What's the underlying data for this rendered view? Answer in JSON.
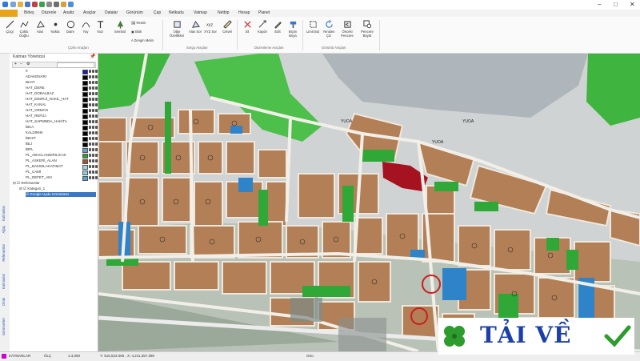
{
  "menu": {
    "file": "",
    "tabs": [
      "Birleş",
      "Düzenle",
      "Analiz",
      "Araçlar",
      "Datalar",
      "Görünüm",
      "Çap",
      "Netkadu",
      "Vatmap",
      "Netbip",
      "Hesap",
      "Planet"
    ]
  },
  "ribbon": {
    "buttons": [
      "Çizgi",
      "Çoklu Doğru",
      "Alan",
      "Nokta",
      "Daire",
      "Yay",
      "Yazı",
      "Sembol",
      "Obje Özellikleri",
      "Alan Sor",
      "XYZ Sor",
      "Cetvel",
      "Sil",
      "Kaydır",
      "Edit",
      "Biçim Boya",
      "Limit Bul",
      "Yeniden Çiz",
      "Önceki Pencere",
      "Pencere Büyüt"
    ],
    "small": [
      "Resim",
      "Blok",
      "Zengin Metin"
    ],
    "groups": [
      "Çizim Araçları",
      "Sorgu Araçları",
      "Düzenleme Araçları",
      "Görüntü Araçları"
    ]
  },
  "layers_panel": {
    "title": "Katman Yöneticisi",
    "items": [
      {
        "name": "0",
        "color": "#1a1ab5"
      },
      {
        "name": "ADAKENARI",
        "color": "#000000"
      },
      {
        "name": "BHAT",
        "color": "#000000"
      },
      {
        "name": "HAT_DERE",
        "color": "#000000"
      },
      {
        "name": "HAT_DOBALBAZ",
        "color": "#000000"
      },
      {
        "name": "HAT_ENERJİ_NAKİL_HAT",
        "color": "#000000"
      },
      {
        "name": "HAT_KANAL",
        "color": "#000000"
      },
      {
        "name": "HAT_ORMAN",
        "color": "#000000"
      },
      {
        "name": "HAT_REFÜJ",
        "color": "#000000"
      },
      {
        "name": "HAT_SAPMNDA_HAKİTA",
        "color": "#000000"
      },
      {
        "name": "İBKA",
        "color": "#000000"
      },
      {
        "name": "KALDIRIM",
        "color": "#000000"
      },
      {
        "name": "İBKST",
        "color": "#000000"
      },
      {
        "name": "İBLİ",
        "color": "#000000"
      },
      {
        "name": "İBPL",
        "color": "#5aa3d8"
      },
      {
        "name": "PL_ABACLANDIRILICAK",
        "color": "#2f9d2f"
      },
      {
        "name": "PL_ASKERİ_ALAN",
        "color": "#a0522d"
      },
      {
        "name": "PL_BAKIMLAKAFIMAT",
        "color": "#9fd0ea"
      },
      {
        "name": "PL_CAMİ",
        "color": "#87ceeb"
      },
      {
        "name": "PL_DEFET_ANI",
        "color": "#55a4cc"
      }
    ],
    "tree": [
      "Referanslar",
      "Kategori_1",
      "Google Uydu Görüntüsü"
    ]
  },
  "side_tabs": [
    "Katmanlar",
    "Ağaç",
    "Referanslar",
    "Katmanlar",
    "Ortak",
    "Görünümler"
  ],
  "map": {
    "labels": [
      "YUOA",
      "YUOA",
      "YUOA"
    ]
  },
  "status": {
    "layer": "KATMANLAR",
    "scale": "ÖLÇ",
    "zoom": "1:4,000",
    "coords": "Y: 516,523.065 , X: 4,211,357.390",
    "mode": "Orto"
  },
  "banner": {
    "text": "TẢI VỀ"
  }
}
